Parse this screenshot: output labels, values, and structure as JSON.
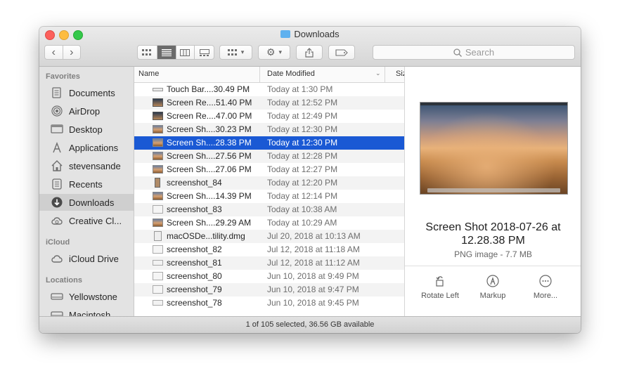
{
  "window": {
    "title": "Downloads"
  },
  "toolbar": {
    "back": "‹",
    "forward": "›",
    "search_placeholder": "Search"
  },
  "sidebar": {
    "favorites_heading": "Favorites",
    "favorites": [
      {
        "label": "Documents",
        "icon": "documents-icon"
      },
      {
        "label": "AirDrop",
        "icon": "airdrop-icon"
      },
      {
        "label": "Desktop",
        "icon": "desktop-icon"
      },
      {
        "label": "Applications",
        "icon": "applications-icon"
      },
      {
        "label": "stevensande",
        "icon": "home-icon"
      },
      {
        "label": "Recents",
        "icon": "recents-icon"
      },
      {
        "label": "Downloads",
        "icon": "downloads-icon",
        "selected": true
      },
      {
        "label": "Creative Cl...",
        "icon": "creative-cloud-icon"
      }
    ],
    "icloud_heading": "iCloud",
    "icloud": [
      {
        "label": "iCloud Drive",
        "icon": "cloud-icon"
      }
    ],
    "locations_heading": "Locations",
    "locations": [
      {
        "label": "Yellowstone",
        "icon": "disk-icon"
      },
      {
        "label": "Macintosh...",
        "icon": "disk-icon"
      }
    ]
  },
  "list": {
    "columns": {
      "name": "Name",
      "date": "Date Modified",
      "size": "Siz"
    },
    "rows": [
      {
        "name": "Touch Bar....30.49 PM",
        "date": "Today at 1:30 PM",
        "thumb": "touchbar"
      },
      {
        "name": "Screen Re....51.40 PM",
        "date": "Today at 12:52 PM",
        "thumb": "movie"
      },
      {
        "name": "Screen Re....47.00 PM",
        "date": "Today at 12:49 PM",
        "thumb": "movie"
      },
      {
        "name": "Screen Sh....30.23 PM",
        "date": "Today at 12:30 PM",
        "thumb": "image"
      },
      {
        "name": "Screen Sh....28.38 PM",
        "date": "Today at 12:30 PM",
        "thumb": "image",
        "selected": true
      },
      {
        "name": "Screen Sh....27.56 PM",
        "date": "Today at 12:28 PM",
        "thumb": "image"
      },
      {
        "name": "Screen Sh....27.06 PM",
        "date": "Today at 12:27 PM",
        "thumb": "image"
      },
      {
        "name": "screenshot_84",
        "date": "Today at 12:20 PM",
        "thumb": "phone"
      },
      {
        "name": "Screen Sh....14.39 PM",
        "date": "Today at 12:14 PM",
        "thumb": "image"
      },
      {
        "name": "screenshot_83",
        "date": "Today at 10:38 AM",
        "thumb": "doc"
      },
      {
        "name": "Screen Sh....29.29 AM",
        "date": "Today at 10:29 AM",
        "thumb": "image"
      },
      {
        "name": "macOSDe...tility.dmg",
        "date": "Jul 20, 2018 at 10:13 AM",
        "thumb": "dmg"
      },
      {
        "name": "screenshot_82",
        "date": "Jul 12, 2018 at 11:18 AM",
        "thumb": "doc"
      },
      {
        "name": "screenshot_81",
        "date": "Jul 12, 2018 at 11:12 AM",
        "thumb": "strip"
      },
      {
        "name": "screenshot_80",
        "date": "Jun 10, 2018 at 9:49 PM",
        "thumb": "doc"
      },
      {
        "name": "screenshot_79",
        "date": "Jun 10, 2018 at 9:47 PM",
        "thumb": "doc"
      },
      {
        "name": "screenshot_78",
        "date": "Jun 10, 2018 at 9:45 PM",
        "thumb": "strip"
      }
    ]
  },
  "preview": {
    "title": "Screen Shot 2018-07-26 at 12.28.38 PM",
    "kind": "PNG image - 7.7 MB",
    "actions": [
      {
        "label": "Rotate Left",
        "icon": "rotate-left-icon"
      },
      {
        "label": "Markup",
        "icon": "markup-icon"
      },
      {
        "label": "More...",
        "icon": "more-icon"
      }
    ]
  },
  "status": {
    "text": "1 of 105 selected, 36.56 GB available"
  },
  "colors": {
    "selection": "#1a59d4",
    "sidebar_bg": "#e3e3e3"
  }
}
